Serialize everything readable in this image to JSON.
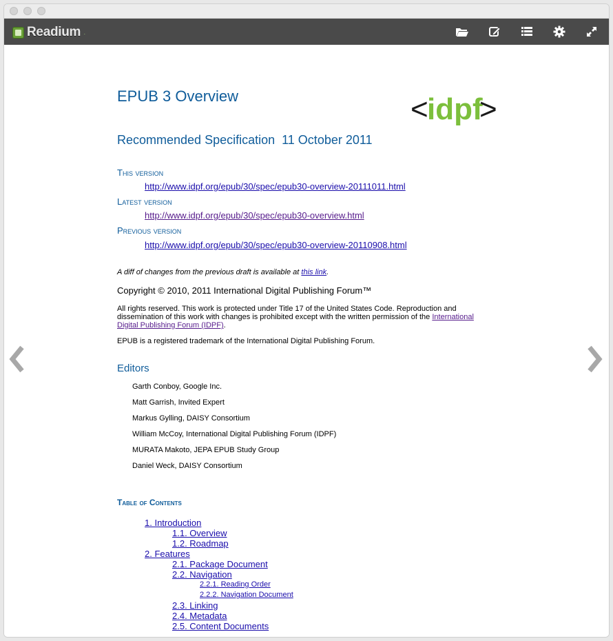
{
  "app": {
    "name": "Readium"
  },
  "toolbar": {
    "buttons": [
      {
        "name": "library",
        "icon": "folder-open-icon"
      },
      {
        "name": "annotate",
        "icon": "edit-icon"
      },
      {
        "name": "toc",
        "icon": "list-icon"
      },
      {
        "name": "settings",
        "icon": "gear-icon"
      },
      {
        "name": "fullscreen",
        "icon": "expand-icon"
      }
    ]
  },
  "doc": {
    "title": "EPUB 3 Overview",
    "logo_text": "<idpf>",
    "subtitle": "Recommended Specification  11 October 2011",
    "this_version_label": "This version",
    "this_version_url": "http://www.idpf.org/epub/30/spec/epub30-overview-20111011.html",
    "latest_version_label": "Latest version",
    "latest_version_url": "http://www.idpf.org/epub/30/spec/epub30-overview.html",
    "previous_version_label": "Previous version",
    "previous_version_url": "http://www.idpf.org/epub/30/spec/epub30-overview-20110908.html",
    "diff_note": "A diff of changes from the previous draft is available at ",
    "diff_link": "this link",
    "diff_end": ".",
    "copyright": "Copyright © 2010, 2011 International Digital Publishing Forum™",
    "rights_line1": "All rights reserved. This work is protected under Title 17 of the United States Code. Reproduction and",
    "rights_line2": "dissemination of this work with changes is prohibited except with the written permission of the ",
    "rights_link1": "International",
    "rights_link2": "Digital Publishing Forum (IDPF)",
    "rights_end": ".",
    "trademark": "EPUB is a registered trademark of the International Digital Publishing Forum.",
    "editors_heading": "Editors",
    "editors": [
      "Garth Conboy, Google Inc.",
      "Matt Garrish, Invited Expert",
      "Markus Gylling, DAISY Consortium",
      "William McCoy, International Digital Publishing Forum (IDPF)",
      "MURATA Makoto, JEPA EPUB Study Group",
      "Daniel Weck, DAISY Consortium"
    ],
    "toc_heading": "Table of Contents",
    "toc": [
      {
        "label": "1. Introduction",
        "level": 1
      },
      {
        "label": "1.1. Overview",
        "level": 2
      },
      {
        "label": "1.2. Roadmap",
        "level": 2
      },
      {
        "label": "2. Features",
        "level": 1
      },
      {
        "label": "2.1. Package Document",
        "level": 2
      },
      {
        "label": "2.2. Navigation",
        "level": 2
      },
      {
        "label": "2.2.1. Reading Order",
        "level": 3
      },
      {
        "label": "2.2.2. Navigation Document",
        "level": 3
      },
      {
        "label": "2.3. Linking",
        "level": 2
      },
      {
        "label": "2.4. Metadata",
        "level": 2
      },
      {
        "label": "2.5. Content Documents",
        "level": 2
      }
    ]
  },
  "nav": {
    "prev_icon": "chevron-left-icon",
    "next_icon": "chevron-right-icon"
  }
}
